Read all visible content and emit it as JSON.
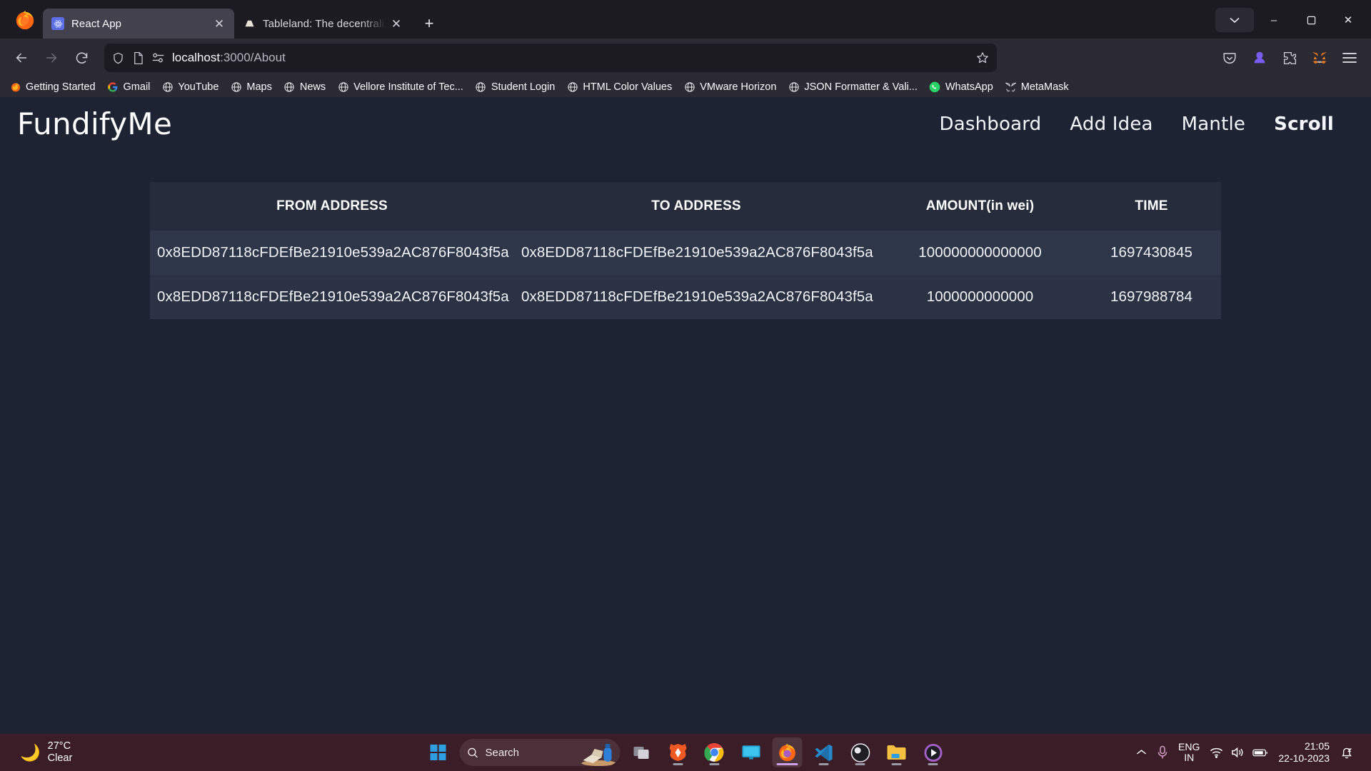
{
  "browser": {
    "tabs": [
      {
        "title": "React App",
        "favicon": "react-icon",
        "active": true
      },
      {
        "title": "Tableland: The decentralized cl",
        "favicon": "tableland-icon",
        "active": false
      }
    ],
    "newtab_label": "+",
    "window_controls": {
      "minimize": "–",
      "maximize": "❐",
      "close": "✕"
    },
    "toolbar": {
      "back": "back-arrow",
      "forward": "forward-arrow",
      "reload": "reload-arrow",
      "shield": "shield-icon",
      "page": "page-icon",
      "tracking": "permissions-icon",
      "url_host": "localhost",
      "url_path": ":3000/About",
      "bookmark_star": "star-icon",
      "pocket": "pocket-icon",
      "account": "account-icon",
      "extensions": "extensions-icon",
      "metamask": "metamask-icon",
      "menu": "hamburger-menu-icon"
    },
    "bookmarks": [
      {
        "label": "Getting Started",
        "icon": "firefox-icon"
      },
      {
        "label": "Gmail",
        "icon": "google-icon"
      },
      {
        "label": "YouTube",
        "icon": "globe-icon"
      },
      {
        "label": "Maps",
        "icon": "globe-icon"
      },
      {
        "label": "News",
        "icon": "globe-icon"
      },
      {
        "label": "Vellore Institute of Tec...",
        "icon": "globe-icon"
      },
      {
        "label": "Student Login",
        "icon": "globe-icon"
      },
      {
        "label": "HTML Color Values",
        "icon": "globe-icon"
      },
      {
        "label": "VMware Horizon",
        "icon": "globe-icon"
      },
      {
        "label": "JSON Formatter & Vali...",
        "icon": "globe-icon"
      },
      {
        "label": "WhatsApp",
        "icon": "whatsapp-icon"
      },
      {
        "label": "MetaMask",
        "icon": "metamask-icon"
      }
    ]
  },
  "page": {
    "brand": "FundifyMe",
    "nav_links": [
      {
        "label": "Dashboard",
        "active": false
      },
      {
        "label": "Add Idea",
        "active": false
      },
      {
        "label": "Mantle",
        "active": false
      },
      {
        "label": "Scroll",
        "active": true
      }
    ],
    "table": {
      "headers": [
        "FROM ADDRESS",
        "TO ADDRESS",
        "AMOUNT(in wei)",
        "TIME"
      ],
      "rows": [
        {
          "from": "0x8EDD87118cFDEfBe21910e539a2AC876F8043f5a",
          "to": "0x8EDD87118cFDEfBe21910e539a2AC876F8043f5a",
          "amount": "100000000000000",
          "time": "1697430845"
        },
        {
          "from": "0x8EDD87118cFDEfBe21910e539a2AC876F8043f5a",
          "to": "0x8EDD87118cFDEfBe21910e539a2AC876F8043f5a",
          "amount": "1000000000000",
          "time": "1697988784"
        }
      ]
    },
    "colors": {
      "background": "#1d2333",
      "table_header_bg": "#262c3c",
      "row_odd_bg": "#2e3649",
      "row_even_bg": "#2b3244",
      "text": "#f2f3f7"
    }
  },
  "taskbar": {
    "weather": {
      "temperature": "27°C",
      "condition": "Clear",
      "icon": "moon-icon"
    },
    "start": "windows-start-icon",
    "search": {
      "placeholder": "Search",
      "icon": "search-icon"
    },
    "apps": [
      {
        "name": "task-view-icon",
        "running": false
      },
      {
        "name": "brave-icon",
        "running": true
      },
      {
        "name": "chrome-icon",
        "running": true
      },
      {
        "name": "remote-desktop-icon",
        "running": false
      },
      {
        "name": "firefox-icon",
        "running": true,
        "active": true
      },
      {
        "name": "vscode-icon",
        "running": true
      },
      {
        "name": "obs-icon",
        "running": true
      },
      {
        "name": "file-explorer-icon",
        "running": true
      },
      {
        "name": "media-player-icon",
        "running": true
      }
    ],
    "tray": {
      "chevron": "show-hidden-icons",
      "mic": "microphone-icon",
      "language_top": "ENG",
      "language_bottom": "IN",
      "wifi": "wifi-icon",
      "volume": "volume-icon",
      "battery": "battery-icon",
      "time": "21:05",
      "date": "22-10-2023",
      "notifications": "notification-bell-icon"
    }
  }
}
